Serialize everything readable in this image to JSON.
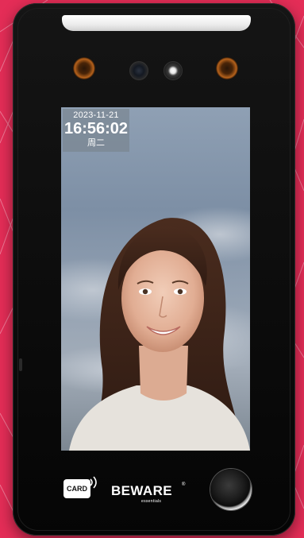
{
  "screen": {
    "date": "2023-11-21",
    "time": "16:56:02",
    "weekday": "周二"
  },
  "card_reader": {
    "label": "CARD"
  },
  "brand": {
    "name": "BEWARE",
    "tagline": "essentials",
    "registered_mark": "®"
  },
  "colors": {
    "background": "#e42d57",
    "device_body": "#0b0b0b",
    "ir_led": "#b5621c"
  },
  "icons": [
    "ir-led-icon",
    "camera-icon",
    "rfid-waves-icon",
    "fingerprint-icon"
  ]
}
